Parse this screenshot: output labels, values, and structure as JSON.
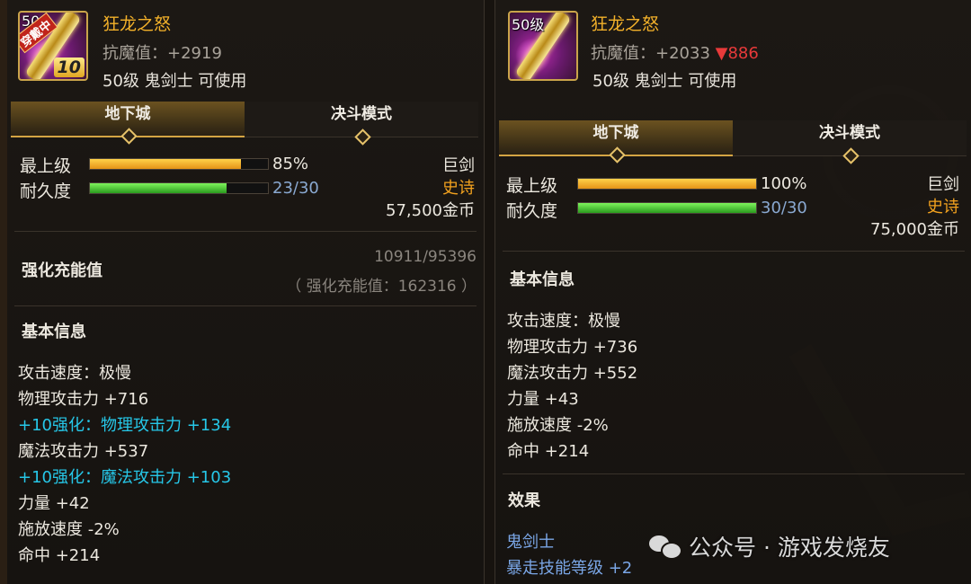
{
  "left": {
    "icon": {
      "level_tag": "50",
      "wear_tag": "穿戴中",
      "plus_tag": "10"
    },
    "name": "狂龙之怒",
    "magic_resist": "抗魔值：+2919",
    "usable": "50级 鬼剑士 可使用",
    "tabs": [
      {
        "label": "地下城",
        "active": true
      },
      {
        "label": "决斗模式",
        "active": false
      }
    ],
    "grade_label": "最上级",
    "grade_value": "85%",
    "grade_fraction": 0.85,
    "durability_label": "耐久度",
    "durability_value": "23/30",
    "durability_fraction": 0.7667,
    "weapon_type": "巨剑",
    "rarity": "史诗",
    "price": "57,500金币",
    "refine": {
      "title": "强化充能值",
      "progress": "10911/95396",
      "total": "（ 强化充能值：162316 ）"
    },
    "basic_title": "基本信息",
    "attrs": [
      {
        "text": "攻击速度：极慢",
        "style": "normal"
      },
      {
        "text": "物理攻击力 +716",
        "style": "normal"
      },
      {
        "text": "+10强化：物理攻击力 +134",
        "style": "cyan"
      },
      {
        "text": "魔法攻击力 +537",
        "style": "normal"
      },
      {
        "text": "+10强化：魔法攻击力 +103",
        "style": "cyan"
      },
      {
        "text": "力量 +42",
        "style": "normal"
      },
      {
        "text": "施放速度 -2%",
        "style": "normal"
      },
      {
        "text": "命中 +214",
        "style": "normal"
      }
    ]
  },
  "right": {
    "icon": {
      "level_tag": "50级"
    },
    "name": "狂龙之怒",
    "magic_resist": "抗魔值：+2033",
    "magic_resist_delta": "▼886",
    "usable": "50级 鬼剑士 可使用",
    "tabs": [
      {
        "label": "地下城",
        "active": true
      },
      {
        "label": "决斗模式",
        "active": false
      }
    ],
    "grade_label": "最上级",
    "grade_value": "100%",
    "grade_fraction": 1.0,
    "durability_label": "耐久度",
    "durability_value": "30/30",
    "durability_fraction": 1.0,
    "weapon_type": "巨剑",
    "rarity": "史诗",
    "price": "75,000金币",
    "basic_title": "基本信息",
    "attrs": [
      {
        "text": "攻击速度：极慢",
        "style": "normal"
      },
      {
        "text": "物理攻击力 +736",
        "style": "normal"
      },
      {
        "text": "魔法攻击力 +552",
        "style": "normal"
      },
      {
        "text": "力量 +43",
        "style": "normal"
      },
      {
        "text": "施放速度 -2%",
        "style": "normal"
      },
      {
        "text": "命中 +214",
        "style": "normal"
      }
    ],
    "effect_title": "效果",
    "effects": [
      {
        "text": "鬼剑士",
        "style": "blue"
      },
      {
        "text": "暴走技能等级 +2",
        "style": "blue"
      }
    ]
  },
  "watermark": "公众号 · 游戏发烧友",
  "colors": {
    "gold": "#f3b12a",
    "epic": "#f3a21e",
    "cyan": "#26c7e8",
    "red": "#e83a3a",
    "durability_blue": "#8aa9d1"
  }
}
